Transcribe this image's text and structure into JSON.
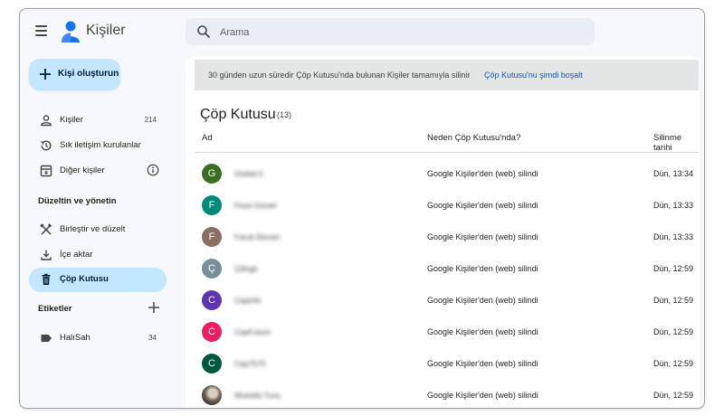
{
  "header": {
    "app_title": "Kişiler",
    "search_placeholder": "Arama"
  },
  "sidebar": {
    "create_label": "Kişi oluşturun",
    "items": [
      {
        "label": "Kişiler",
        "count": "214"
      },
      {
        "label": "Sık iletişim kurulanlar"
      },
      {
        "label": "Diğer kişiler"
      }
    ],
    "fix_section_title": "Düzeltin ve yönetin",
    "fix_items": [
      {
        "label": "Birleştir ve düzelt"
      },
      {
        "label": "İçe aktar"
      },
      {
        "label": "Çöp Kutusu"
      }
    ],
    "labels_section_title": "Etiketler",
    "labels": [
      {
        "label": "HalıSah",
        "count": "34"
      }
    ]
  },
  "main": {
    "banner_text": "30 günden uzun süredir Çöp Kutusu'nda bulunan Kişiler tamamıyla silinir",
    "banner_link": "Çöp Kutusu'nu şimdi boşalt",
    "title": "Çöp Kutusu",
    "count": "(13)",
    "columns": {
      "name": "Ad",
      "reason": "Neden Çöp Kutusu'nda?",
      "date": "Silinme tarihi"
    },
    "rows": [
      {
        "initial": "G",
        "color": "#3b6e23",
        "name": "Global 5",
        "reason": "Google Kişiler'den (web) silindi",
        "date": "Dün, 13:34"
      },
      {
        "initial": "F",
        "color": "#00897b",
        "name": "Feza Gürsel",
        "reason": "Google Kişiler'den (web) silindi",
        "date": "Dün, 13:33"
      },
      {
        "initial": "F",
        "color": "#8d6e63",
        "name": "Faruk Ekmen",
        "reason": "Google Kişiler'den (web) silindi",
        "date": "Dün, 13:33"
      },
      {
        "initial": "Ç",
        "color": "#78909c",
        "name": "Çilingir",
        "reason": "Google Kişiler'den (web) silindi",
        "date": "Dün, 12:59"
      },
      {
        "initial": "C",
        "color": "#5e35b1",
        "name": "Capinfo",
        "reason": "Google Kişiler'den (web) silindi",
        "date": "Dün, 12:59"
      },
      {
        "initial": "C",
        "color": "#e91e63",
        "name": "CapFuture",
        "reason": "Google Kişiler'den (web) silindi",
        "date": "Dün, 12:59"
      },
      {
        "initial": "C",
        "color": "#00573f",
        "name": "Cap7575",
        "reason": "Google Kişiler'den (web) silindi",
        "date": "Dün, 12:59"
      },
      {
        "initial": "",
        "color": "",
        "name": "Mustafa Tunç",
        "reason": "Google Kişiler'den (web) silindi",
        "date": "Dün, 12:59"
      }
    ]
  }
}
